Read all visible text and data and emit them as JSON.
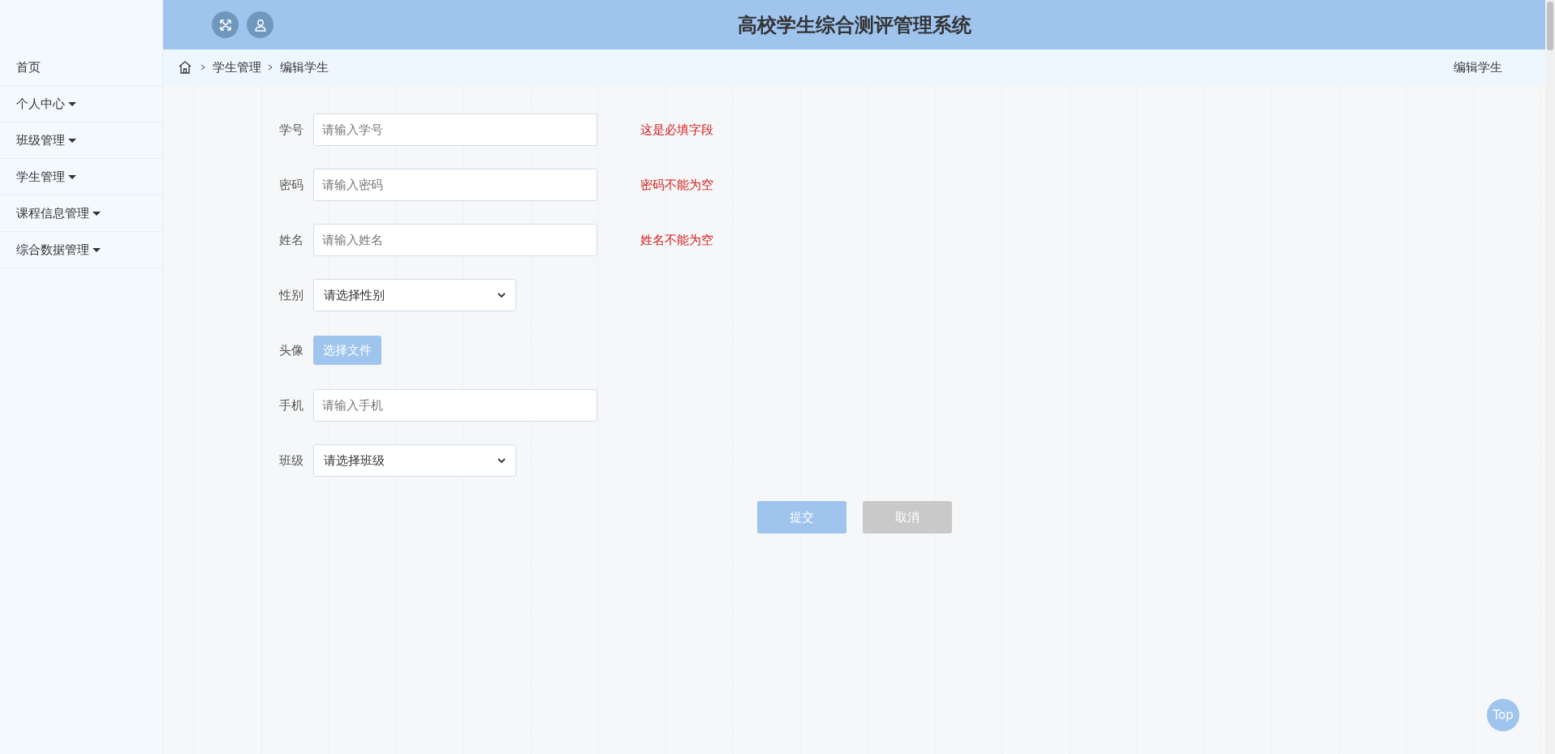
{
  "header": {
    "title": "高校学生综合测评管理系统"
  },
  "sidebar": {
    "items": [
      {
        "label": "首页",
        "has_dropdown": false
      },
      {
        "label": "个人中心",
        "has_dropdown": true
      },
      {
        "label": "班级管理",
        "has_dropdown": true
      },
      {
        "label": "学生管理",
        "has_dropdown": true
      },
      {
        "label": "课程信息管理",
        "has_dropdown": true
      },
      {
        "label": "综合数据管理",
        "has_dropdown": true
      }
    ]
  },
  "breadcrumb": {
    "items": [
      "学生管理",
      "编辑学生"
    ],
    "page_title": "编辑学生"
  },
  "form": {
    "fields": [
      {
        "kind": "text",
        "label": "学号",
        "placeholder": "请输入学号",
        "error": "这是必填字段"
      },
      {
        "kind": "text",
        "label": "密码",
        "placeholder": "请输入密码",
        "error": "密码不能为空"
      },
      {
        "kind": "text",
        "label": "姓名",
        "placeholder": "请输入姓名",
        "error": "姓名不能为空"
      },
      {
        "kind": "select",
        "label": "性别",
        "value": "请选择性别"
      },
      {
        "kind": "file",
        "label": "头像",
        "button": "选择文件"
      },
      {
        "kind": "text",
        "label": "手机",
        "placeholder": "请输入手机"
      },
      {
        "kind": "select",
        "label": "班级",
        "value": "请选择班级"
      }
    ],
    "buttons": [
      {
        "kind": "primary",
        "label": "提交"
      },
      {
        "kind": "secondary",
        "label": "取消"
      }
    ]
  },
  "back_to_top": "Top"
}
